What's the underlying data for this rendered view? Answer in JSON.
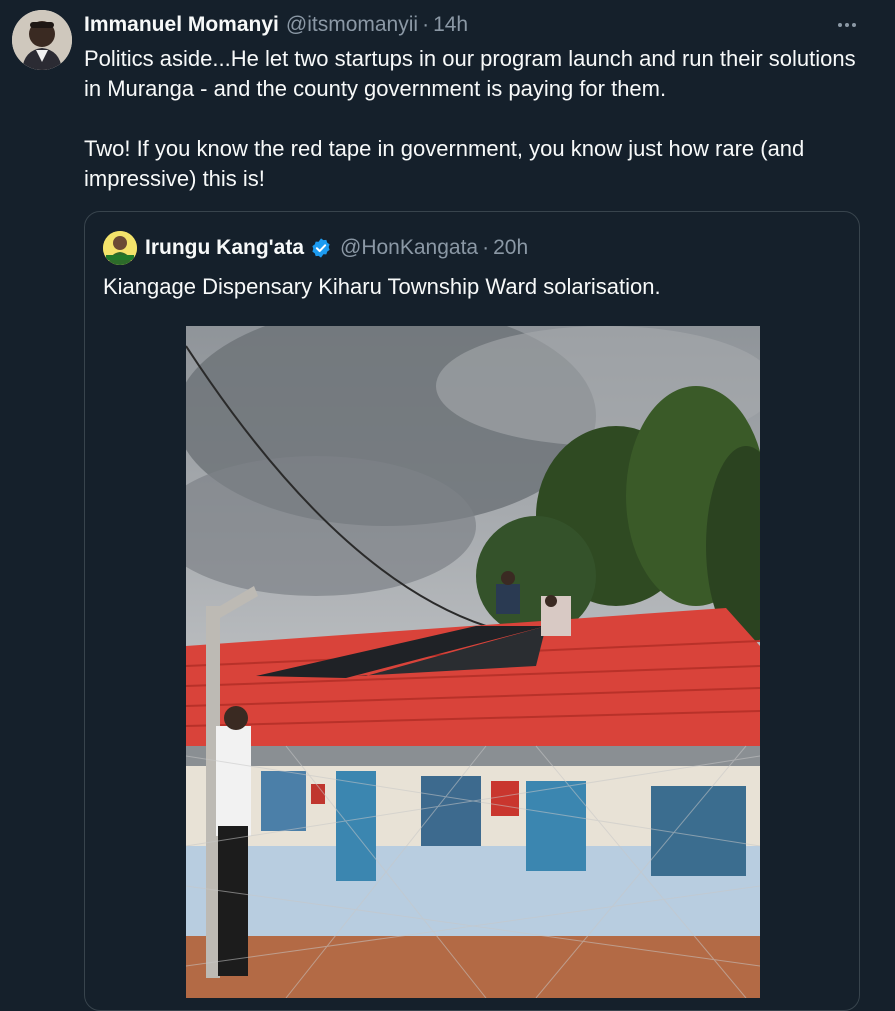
{
  "tweet": {
    "author_name": "Immanuel Momanyi",
    "handle": "@itsmomanyii",
    "separator": "·",
    "time": "14h",
    "more_icon": "more-horizontal-icon",
    "paragraphs": [
      "Politics aside...He let two startups in our program launch and run their solutions in Muranga - and the county government is paying for them.",
      "Two! If you know the red tape in government, you know just how rare (and impressive) this is!"
    ]
  },
  "quoted": {
    "author_name": "Irungu Kang'ata",
    "verified_icon": "verified-badge-icon",
    "handle": "@HonKangata",
    "separator": "·",
    "time": "20h",
    "text": "Kiangage Dispensary Kiharu Township Ward solarisation.",
    "photo": "photo of workers installing solar panels on a red iron-sheet roof of a dispensary building"
  },
  "colors": {
    "background": "#15202b",
    "primary_text": "#f7f9f9",
    "secondary_text": "#8b98a5",
    "border": "#38444d",
    "verified": "#1d9bf0"
  }
}
